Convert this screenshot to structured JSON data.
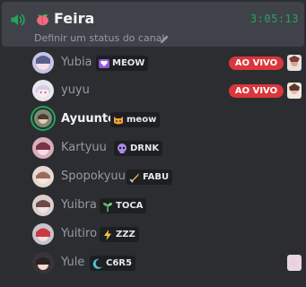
{
  "channel": {
    "name": "Feira",
    "timer": "3:05:13",
    "status_placeholder": "Definir um status do canal",
    "icon": "speaker-icon",
    "emoji": "peach-emoji",
    "accent_color": "#23a55a"
  },
  "members": [
    {
      "name": "Yubia",
      "tag": "MEOW",
      "tag_icon": "purple-heart-icon",
      "live": "AO VIVO",
      "highlight": false
    },
    {
      "name": "yuyu",
      "tag": "",
      "live": "AO VIVO",
      "highlight": false
    },
    {
      "name": "Ayuunto",
      "tag": "meow",
      "tag_icon": "cat-icon",
      "live": "",
      "highlight": true
    },
    {
      "name": "Kartyuu",
      "tag": "DRNK",
      "tag_icon": "skull-icon",
      "live": "",
      "highlight": false
    },
    {
      "name": "Spopokyuu",
      "tag": "FABU",
      "tag_icon": "sword-icon",
      "live": "",
      "highlight": false
    },
    {
      "name": "Yuibra",
      "tag": "TOCA",
      "tag_icon": "sprout-icon",
      "live": "",
      "highlight": false
    },
    {
      "name": "Yuitiro",
      "tag": "ZZZ",
      "tag_icon": "lightning-icon",
      "live": "",
      "highlight": false
    },
    {
      "name": "Yule",
      "tag": "C6R5",
      "tag_icon": "moon-icon",
      "live": "",
      "highlight": false
    }
  ],
  "colors": {
    "live_badge": "#da373c",
    "background": "#2b2d31",
    "selected_channel": "#404249"
  }
}
